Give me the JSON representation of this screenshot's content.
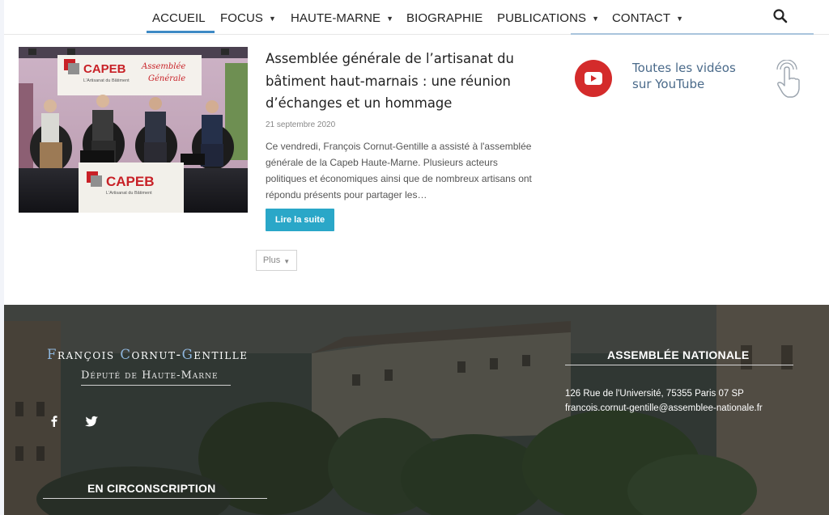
{
  "nav": {
    "items": [
      {
        "label": "ACCUEIL",
        "has_dropdown": false,
        "active": true
      },
      {
        "label": "FOCUS",
        "has_dropdown": true,
        "active": false
      },
      {
        "label": "HAUTE-MARNE",
        "has_dropdown": true,
        "active": false
      },
      {
        "label": "BIOGRAPHIE",
        "has_dropdown": false,
        "active": false
      },
      {
        "label": "PUBLICATIONS",
        "has_dropdown": true,
        "active": false
      },
      {
        "label": "CONTACT",
        "has_dropdown": true,
        "active": false
      }
    ],
    "search_icon": "search-icon",
    "accent_color": "#3e8ac5"
  },
  "article": {
    "title": "Assemblée générale de l’artisanat du bâtiment haut-marnais : une réunion d’échanges et un hommage",
    "date": "21 septembre 2020",
    "excerpt": "Ce vendredi, François Cornut-Gentille a assisté à l'assemblée générale de la Capeb Haute-Marne. Plusieurs acteurs politiques et économiques ainsi que de nombreux artisans ont répondu présents pour partager les…",
    "read_more": "Lire la suite",
    "image": {
      "banner_brand": "CAPEB",
      "banner_sub": "L'Artisanat du Bâtiment",
      "banner_script_1": "Assemblée",
      "banner_script_2": "Générale",
      "desk_brand": "CAPEB",
      "desk_sub": "L'Artisanat du Bâtiment"
    }
  },
  "more_button": "Plus",
  "youtube": {
    "line1": "Toutes les vidéos",
    "line2": "sur YouTube",
    "icon": "youtube-icon",
    "brand_color": "#d42b2b"
  },
  "footer": {
    "name": {
      "first_initial": "F",
      "first_rest": "rançois ",
      "mid_initial": "C",
      "mid_rest": "ornut-",
      "last_initial": "G",
      "last_rest": "entille"
    },
    "role": "Député de Haute-Marne",
    "social": [
      "facebook-icon",
      "twitter-icon"
    ],
    "assemblee": {
      "heading": "ASSEMBLÉE NATIONALE",
      "address": "126 Rue de l'Université, 75355 Paris 07 SP",
      "email": "francois.cornut-gentille@assemblee-nationale.fr"
    },
    "circonscription": {
      "heading": "EN CIRCONSCRIPTION"
    }
  }
}
